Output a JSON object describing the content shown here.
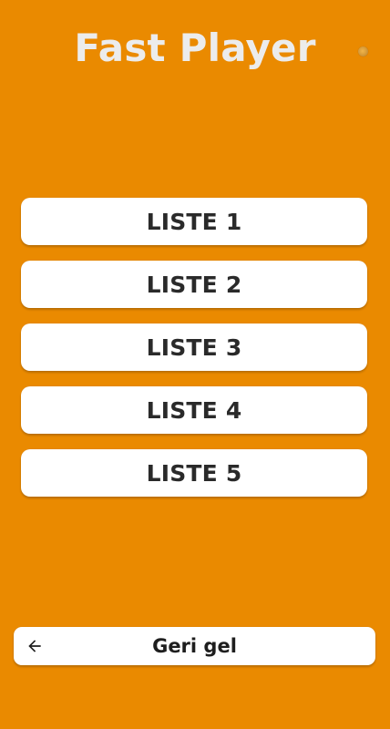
{
  "app": {
    "title": "Fast Player"
  },
  "lists": [
    {
      "label": "LISTE 1"
    },
    {
      "label": "LISTE 2"
    },
    {
      "label": "LISTE 3"
    },
    {
      "label": "LISTE 4"
    },
    {
      "label": "LISTE 5"
    }
  ],
  "footer": {
    "back_label": "Geri gel",
    "back_icon": "arrow-left-icon"
  },
  "colors": {
    "background": "#EA8A00",
    "button": "#FFFFFF",
    "title": "#ECECEC",
    "text": "#2A2A2A"
  }
}
